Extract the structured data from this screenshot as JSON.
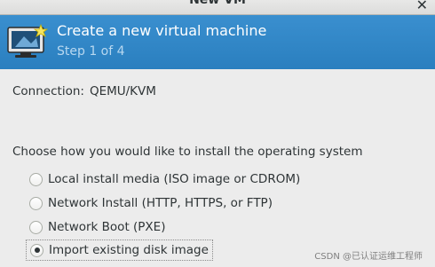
{
  "window": {
    "title": "New VM"
  },
  "banner": {
    "heading": "Create a new virtual machine",
    "step": "Step 1 of 4",
    "icon": "virtual-machine-new-icon"
  },
  "connection": {
    "label": "Connection:",
    "value": "QEMU/KVM"
  },
  "install": {
    "prompt": "Choose how you would like to install the operating system",
    "options": [
      {
        "label": "Local install media (ISO image or CDROM)",
        "selected": false
      },
      {
        "label": "Network Install (HTTP, HTTPS, or FTP)",
        "selected": false
      },
      {
        "label": "Network Boot (PXE)",
        "selected": false
      },
      {
        "label": "Import existing disk image",
        "selected": true
      }
    ]
  },
  "watermark": "CSDN @已认证运维工程师",
  "colors": {
    "banner": "#2f86c6",
    "background": "#ececec"
  }
}
